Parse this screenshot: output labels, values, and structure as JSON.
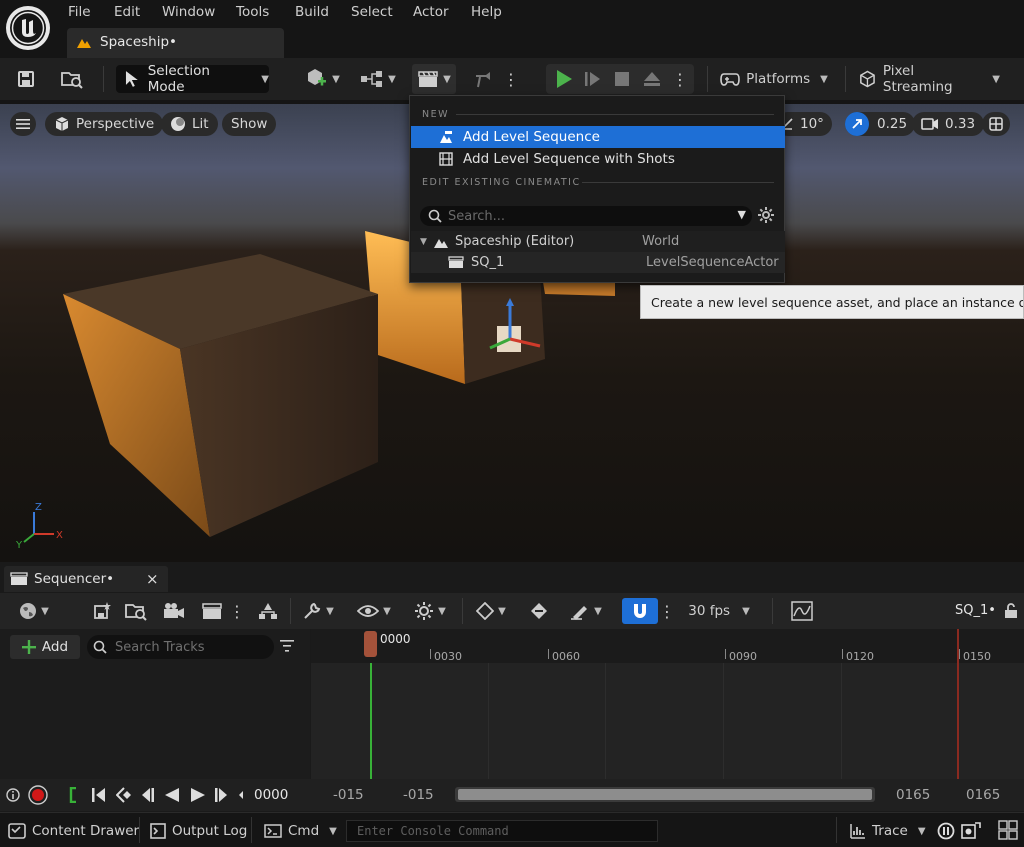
{
  "menu": [
    "File",
    "Edit",
    "Window",
    "Tools",
    "Build",
    "Select",
    "Actor",
    "Help"
  ],
  "document_tab": {
    "title": "Spaceship•"
  },
  "toolbar": {
    "selection_mode": "Selection Mode",
    "platforms": "Platforms",
    "pixel_streaming": "Pixel Streaming"
  },
  "viewport": {
    "menu_icon": "hamburger-icon",
    "perspective": "Perspective",
    "lit": "Lit",
    "show": "Show",
    "angle_snap": "10°",
    "scale_snap": "0.25",
    "camera_speed": "0.33",
    "axis_labels": {
      "z": "Z",
      "y": "Y",
      "x": "X"
    }
  },
  "cinematics_menu": {
    "section_new": "NEW",
    "add_level_sequence": "Add Level Sequence",
    "add_level_sequence_with_shots": "Add Level Sequence with Shots",
    "section_edit": "EDIT EXISTING CINEMATIC",
    "search_placeholder": "Search...",
    "tree": [
      {
        "name": "Spaceship (Editor)",
        "type": "World"
      },
      {
        "name": "SQ_1",
        "type": "LevelSequenceActor"
      }
    ]
  },
  "tooltip": "Create a new level sequence asset, and place an instance of it in this level",
  "sequencer": {
    "tab_title": "Sequencer•",
    "close": "×",
    "add_label": "Add",
    "search_tracks_placeholder": "Search Tracks",
    "fps": "30 fps",
    "sequence_name": "SQ_1•",
    "playhead_frame": "0000",
    "ruler_labels": [
      "0030",
      "0060",
      "0090",
      "0120",
      "0150"
    ],
    "current_frame": "0000",
    "view_start": "-015",
    "work_start": "-015",
    "work_end": "0165",
    "view_end": "0165"
  },
  "statusbar": {
    "content_drawer": "Content Drawer",
    "output_log": "Output Log",
    "cmd": "Cmd",
    "console_placeholder": "Enter Console Command",
    "trace": "Trace"
  },
  "colors": {
    "accent": "#1e6fd6",
    "play_green": "#4cb34c",
    "playhead": "#a4523a",
    "tab_icon": "#f0a000"
  }
}
